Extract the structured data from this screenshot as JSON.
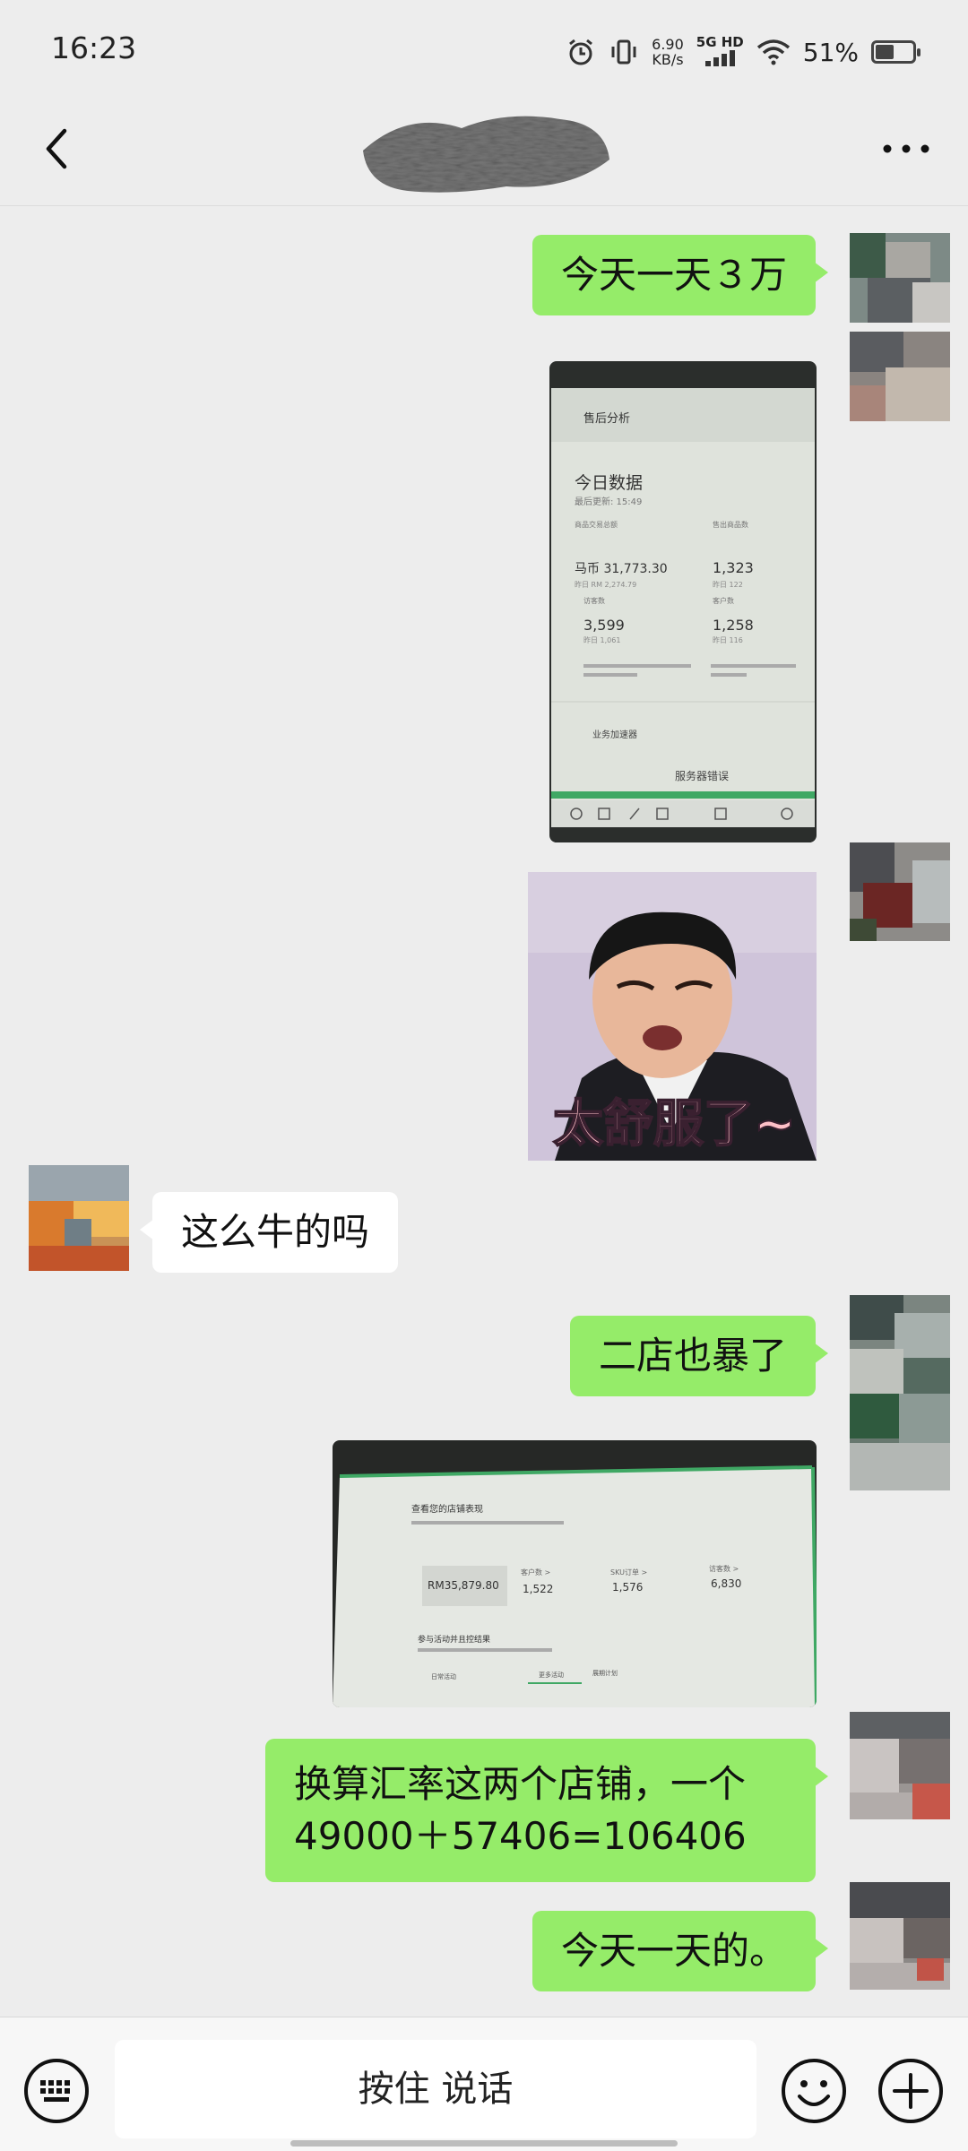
{
  "status_bar": {
    "time": "16:23",
    "net_speed_value": "6.90",
    "net_speed_unit": "KB/s",
    "signal_label_top": "5G HD",
    "battery": "51%",
    "battery_level": 0.51
  },
  "header": {
    "back_icon": "chevron-left-icon",
    "title": "",
    "more_icon": "more-dots-icon"
  },
  "messages": [
    {
      "type": "text",
      "from": "me",
      "text": "今天一天３万"
    },
    {
      "type": "image",
      "from": "me",
      "description_icon": "screenshot-photo"
    },
    {
      "type": "sticker",
      "from": "me",
      "sticker_text": "太舒服了~"
    },
    {
      "type": "text",
      "from": "other",
      "text": "这么牛的吗"
    },
    {
      "type": "text",
      "from": "me",
      "text": "二店也暴了"
    },
    {
      "type": "image",
      "from": "me",
      "description_icon": "screenshot-photo"
    },
    {
      "type": "text",
      "from": "me",
      "text": "换算汇率这两个店铺，一个49000＋57406=106406"
    },
    {
      "type": "text",
      "from": "me",
      "text": "今天一天的。"
    }
  ],
  "photo1": {
    "heading": "售后分析",
    "title": "今日数据",
    "updated": "最后更新: 15:49",
    "gmv_label": "商品交易总额",
    "gmv_value": "马币 31,773.30",
    "gmv_prev": "昨日 RM 2,274.79",
    "sold_label": "售出商品数",
    "sold_value": "1,323",
    "sold_prev": "昨日 122",
    "visitors_label": "访客数",
    "visitors_value": "3,599",
    "visitors_prev": "昨日 1,061",
    "customers_label": "客户数",
    "customers_value": "1,258",
    "customers_prev": "昨日 116",
    "footer1": "业务加速器",
    "footer2": "服务器错误"
  },
  "photo2": {
    "title": "查看您的店铺表现",
    "gmv_value": "RM35,879.80",
    "customers_label": "客户数 >",
    "customers_value": "1,522",
    "sku_label": "SKU订单 >",
    "sku_value": "1,576",
    "visitors_label": "访客数 >",
    "visitors_value": "6,830",
    "section": "参与活动并且控结果",
    "tab1": "日常活动",
    "tab2": "更多活动",
    "tab3": "展期计划"
  },
  "input_bar": {
    "keyboard_icon": "keyboard-icon",
    "voice_label": "按住 说话",
    "emoji_icon": "emoji-icon",
    "plus_icon": "plus-circle-icon"
  },
  "colors": {
    "background": "#ededed",
    "outgoing_bubble": "#95ec69",
    "incoming_bubble": "#ffffff"
  }
}
